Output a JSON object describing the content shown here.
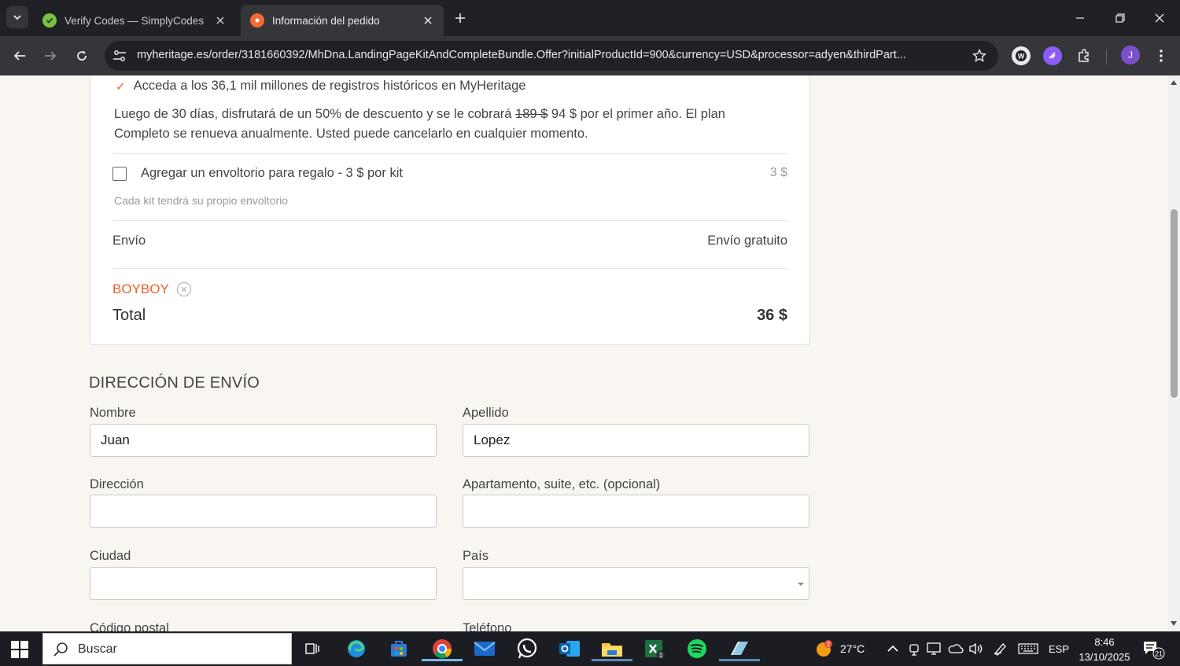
{
  "browser": {
    "tabs": [
      {
        "title": "Verify Codes — SimplyCodes",
        "active": false
      },
      {
        "title": "Información del pedido",
        "active": true
      }
    ],
    "url": "myheritage.es/order/3181660392/MhDna.LandingPageKitAndCompleteBundle.Offer?initialProductId=900&currency=USD&processor=adyen&thirdPart...",
    "profile_initial": "J"
  },
  "summary": {
    "benefit": "Acceda a los 36,1 mil millones de registros históricos en MyHeritage",
    "renewal_prefix": "Luego de 30 días, disfrutará de un 50% de descuento y se le cobrará ",
    "renewal_old_price": "189 $",
    "renewal_suffix": " 94 $ por el primer año. El plan Completo se renueva anualmente. Usted puede cancelarlo en cualquier momento.",
    "gift_label": "Agregar un envoltorio para regalo - 3 $ por kit",
    "gift_price": "3 $",
    "gift_checked": false,
    "gift_note": "Cada kit tendrá su propio envoltorio",
    "shipping_label": "Envío",
    "shipping_value": "Envío gratuito",
    "coupon_code": "BOYBOY",
    "total_label": "Total",
    "total_value": "36 $"
  },
  "shipping_form": {
    "title": "DIRECCIÓN DE ENVÍO",
    "first_name_label": "Nombre",
    "first_name_value": "Juan",
    "last_name_label": "Apellido",
    "last_name_value": "Lopez",
    "address_label": "Dirección",
    "address_value": "",
    "apartment_label": "Apartamento, suite, etc. (opcional)",
    "apartment_value": "",
    "city_label": "Ciudad",
    "city_value": "",
    "country_label": "País",
    "country_value": "",
    "postal_label": "Código postal",
    "phone_label": "Teléfono"
  },
  "taskbar": {
    "search_placeholder": "Buscar",
    "weather_temp": "27°C",
    "weather_badge": "2",
    "language": "ESP",
    "time": "8:46",
    "date": "13/10/2025",
    "notification_count": "21",
    "xbox_badge": "1"
  },
  "colors": {
    "accent_orange": "#e8612c",
    "page_background": "#f9f6f1",
    "chrome_dark": "#202124",
    "chrome_toolbar": "#35363a"
  }
}
